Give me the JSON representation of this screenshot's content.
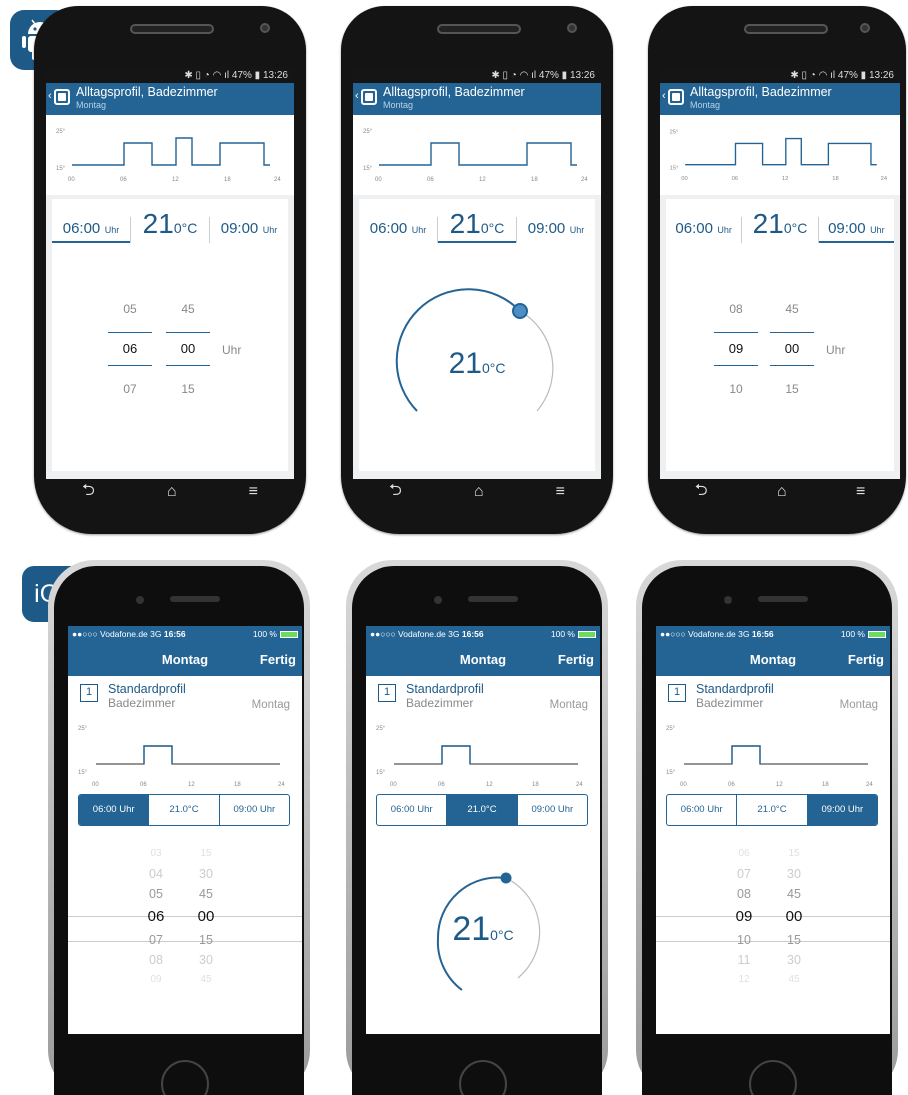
{
  "platform_labels": {
    "android": "android-robot-icon",
    "ios": "iOS"
  },
  "colors": {
    "primary": "#236495",
    "accent": "#1e5a87",
    "status_bar": "#151515",
    "background": "#eef0f2"
  },
  "android": {
    "status_time": "13:26",
    "status_battery": "47%",
    "appbar_title": "Alltagsprofil, Badezimmer",
    "appbar_subtitle": "Montag",
    "graph": {
      "ylabels": [
        "25°",
        "15°"
      ],
      "xticks": [
        "00",
        "06",
        "12",
        "18",
        "24"
      ]
    },
    "tabs": {
      "start_value": "06:00",
      "start_unit": "Uhr",
      "temp_value": "21",
      "temp_unit": "0°C",
      "end_value": "09:00",
      "end_unit": "Uhr"
    },
    "screen1": {
      "hours": [
        "05",
        "06",
        "07"
      ],
      "minutes": [
        "45",
        "00",
        "15"
      ],
      "unit": "Uhr"
    },
    "screen2": {
      "dial_value": "21",
      "dial_unit": "0°C"
    },
    "screen3": {
      "hours": [
        "08",
        "09",
        "10"
      ],
      "minutes": [
        "45",
        "00",
        "15"
      ],
      "unit": "Uhr"
    },
    "nav_icons": [
      "back-icon",
      "home-icon",
      "menu-icon"
    ]
  },
  "ios": {
    "status": {
      "carrier": "●●○○○ Vodafone.de",
      "network": "3G",
      "time": "16:56",
      "battery": "100 %"
    },
    "nav_title": "Montag",
    "done_label": "Fertig",
    "profile_number": "1",
    "profile_name": "Standardprofil",
    "room": "Badezimmer",
    "day": "Montag",
    "graph": {
      "ylabels": [
        "25°",
        "15°"
      ],
      "xticks": [
        "00",
        "06",
        "12",
        "18",
        "24"
      ]
    },
    "segments": {
      "start": "06:00 Uhr",
      "temp": "21.0°C",
      "end": "09:00 Uhr"
    },
    "screen1": {
      "hours": [
        "03",
        "04",
        "05",
        "06",
        "07",
        "08",
        "09"
      ],
      "minutes": [
        "15",
        "30",
        "45",
        "00",
        "15",
        "30",
        "45"
      ]
    },
    "screen2": {
      "dial_value": "21",
      "dial_unit": "0°C"
    },
    "screen3": {
      "hours": [
        "06",
        "07",
        "08",
        "09",
        "10",
        "11",
        "12"
      ],
      "minutes": [
        "15",
        "30",
        "45",
        "00",
        "15",
        "30",
        "45"
      ]
    }
  }
}
